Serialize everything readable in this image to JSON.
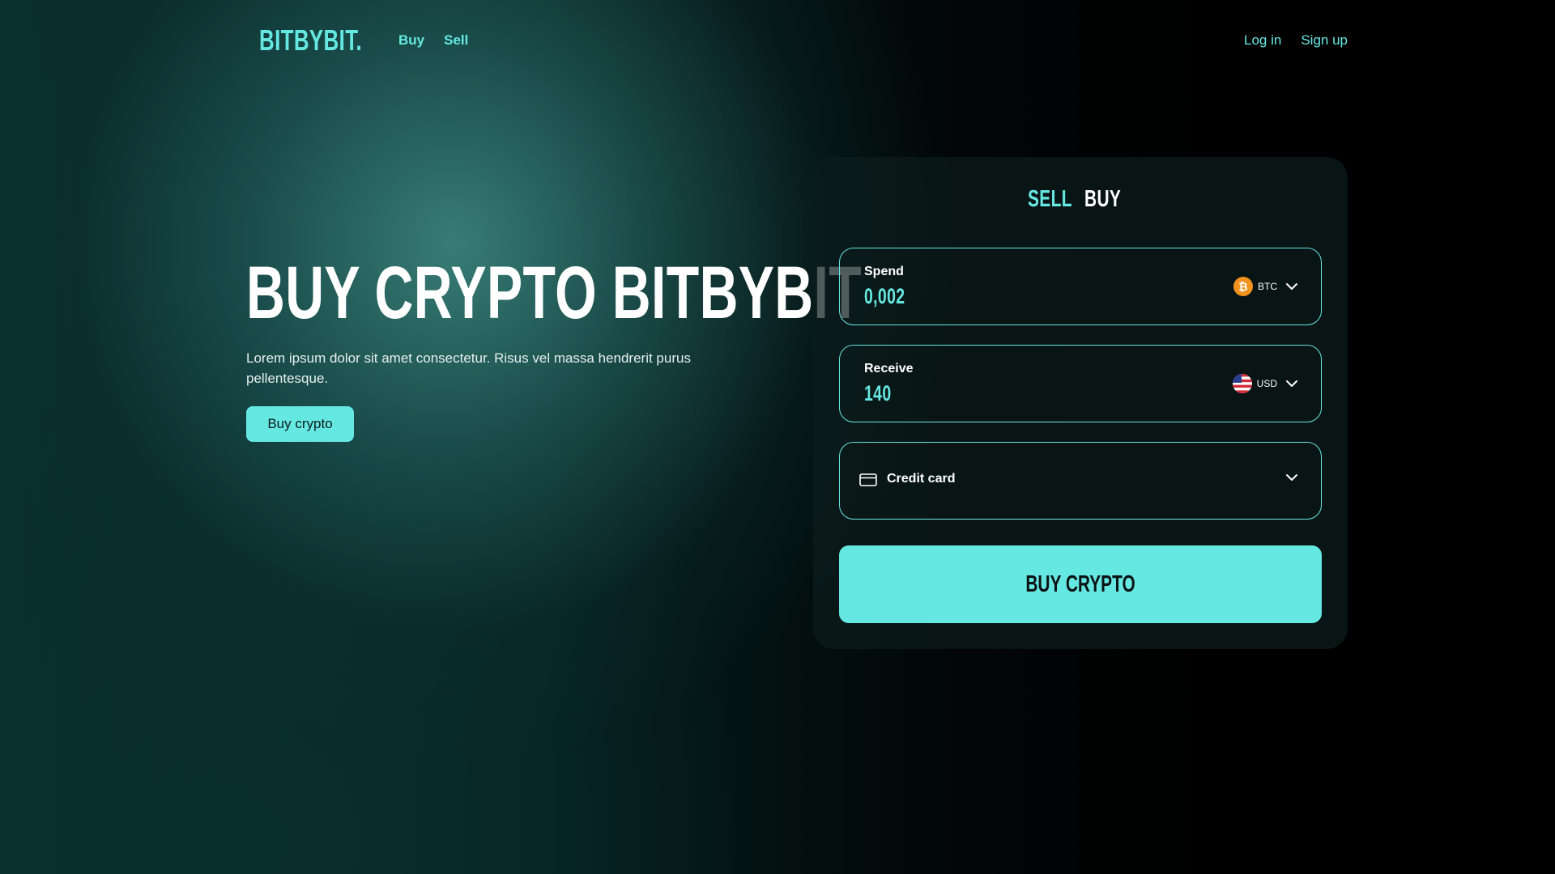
{
  "brand": {
    "logo": "BITBYBIT.",
    "accent": "#66e8e2"
  },
  "nav": {
    "links": [
      {
        "label": "Buy"
      },
      {
        "label": "Sell"
      }
    ],
    "auth": {
      "login": "Log in",
      "signup": "Sign up"
    }
  },
  "hero": {
    "title": "BUY CRYPTO BITBYBIT",
    "text": "Lorem ipsum dolor sit amet consectetur. Risus vel massa hendrerit purus pellentesque.",
    "button": "Buy crypto"
  },
  "exchange": {
    "tabs": [
      {
        "label": "SELL"
      },
      {
        "label": "BUY"
      }
    ],
    "spend": {
      "label": "Spend",
      "value": "0,002",
      "currency": "BTC",
      "icon": "bitcoin-icon"
    },
    "receive": {
      "label": "Receive",
      "value": "140",
      "currency": "USD",
      "icon": "us-flag-icon"
    },
    "payment": {
      "label": "Credit card",
      "icon": "credit-card-icon"
    },
    "submit": "BUY CRYPTO"
  }
}
